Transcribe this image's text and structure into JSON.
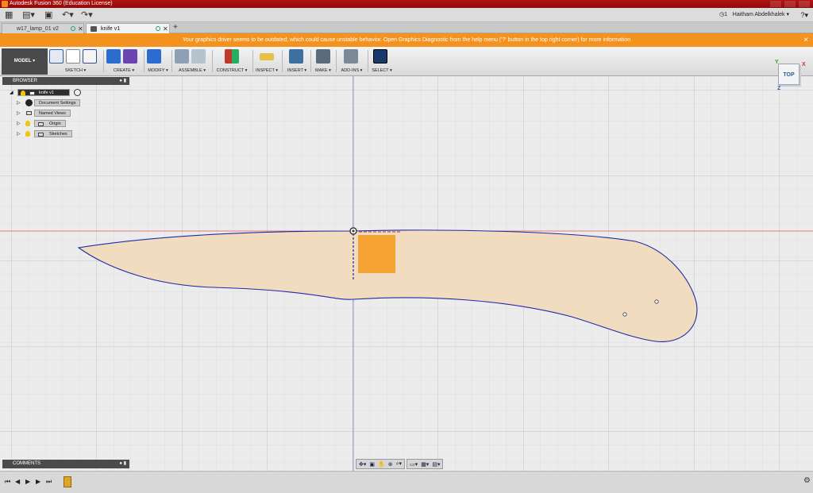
{
  "window": {
    "title": "Autodesk Fusion 360 (Education License)"
  },
  "quick_access": {
    "jobs_count": "1",
    "user_name": "Haitham Abdelkhalek",
    "help_label": "?"
  },
  "tabs": [
    {
      "label": "w17_lamp_01 v2"
    },
    {
      "label": "knife v1"
    }
  ],
  "warning": {
    "message": "Your graphics driver seems to be outdated, which could cause unstable behavior. Open Graphics Diagnostic from the help menu ('?' button in the top right corner) for more information",
    "close": "×"
  },
  "toolbar": {
    "workspace": "MODEL ▾",
    "groups": [
      {
        "label": "SKETCH ▾"
      },
      {
        "label": "CREATE ▾"
      },
      {
        "label": "MODIFY ▾"
      },
      {
        "label": "ASSEMBLE ▾"
      },
      {
        "label": "CONSTRUCT ▾"
      },
      {
        "label": "INSPECT ▾"
      },
      {
        "label": "INSERT ▾"
      },
      {
        "label": "MAKE ▾"
      },
      {
        "label": "ADD-INS ▾"
      },
      {
        "label": "SELECT ▾"
      }
    ]
  },
  "browser": {
    "title": "BROWSER",
    "root": "knife v1",
    "items": [
      {
        "label": "Document Settings"
      },
      {
        "label": "Named Views"
      },
      {
        "label": "Origin"
      },
      {
        "label": "Sketches"
      }
    ]
  },
  "viewcube": {
    "face": "TOP",
    "axis_x": "X",
    "axis_y": "Y",
    "axis_z": "Z"
  },
  "comments": {
    "title": "COMMENTS"
  },
  "colors": {
    "accent": "#f4921f",
    "titlebar": "#a50f0f",
    "sketch_fill": "#f2dcc0",
    "sketch_line": "#1f2aa8",
    "rect_fill": "#f5a332"
  }
}
